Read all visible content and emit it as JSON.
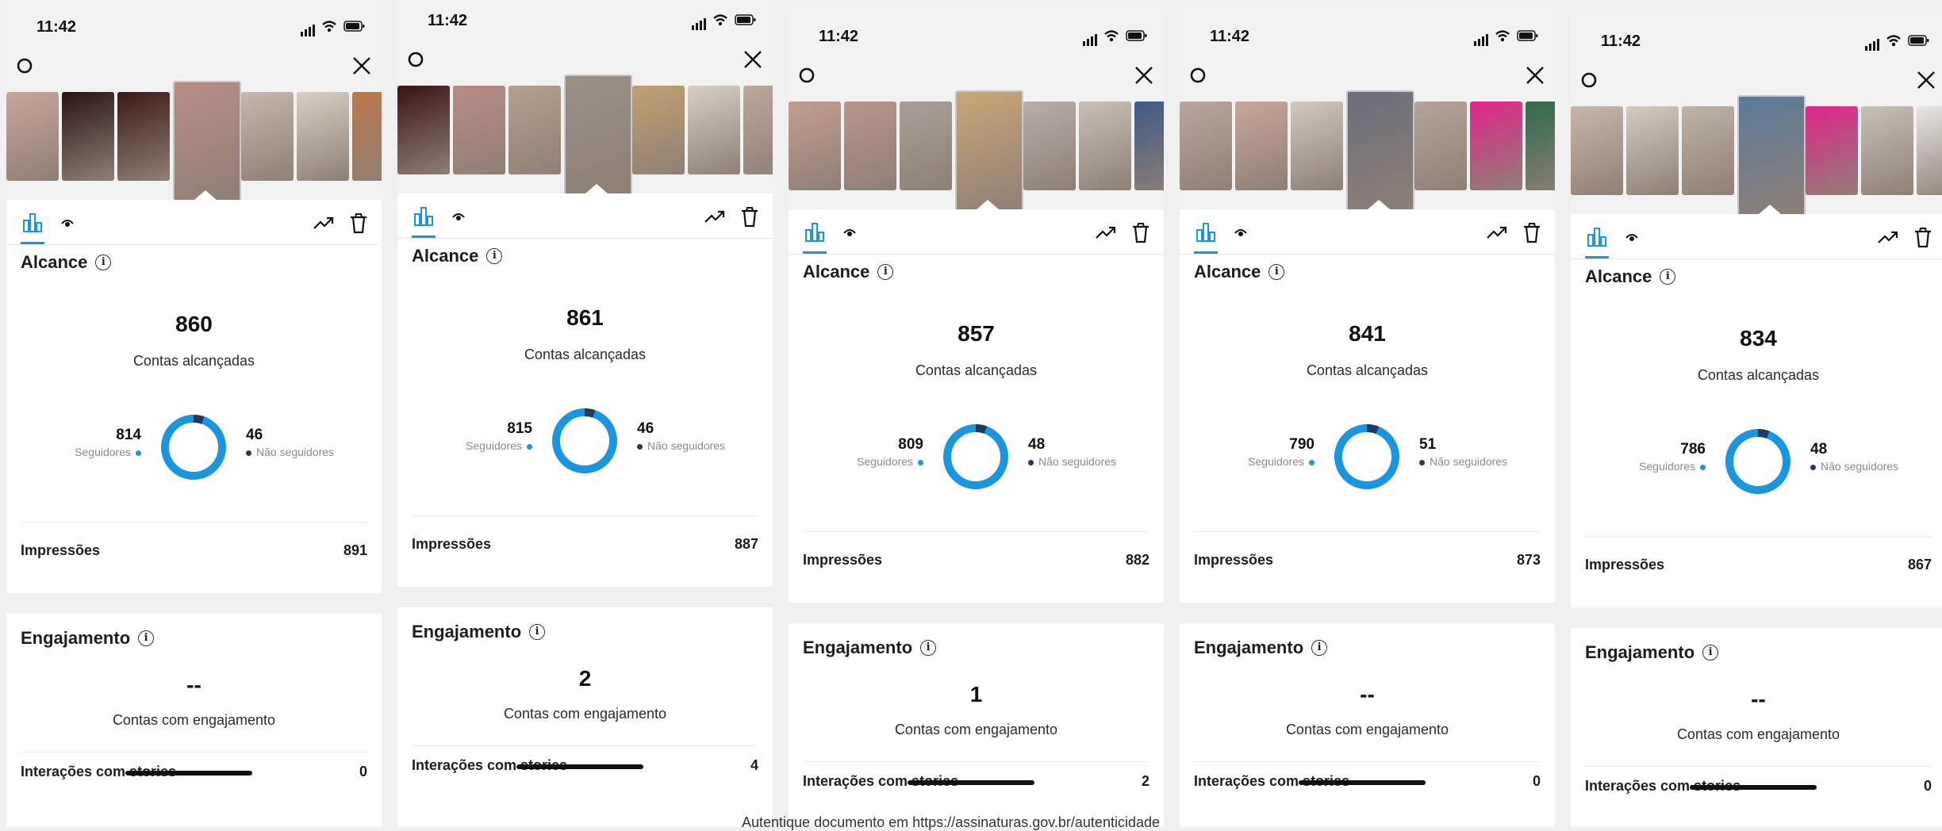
{
  "status": {
    "time": "11:42"
  },
  "labels": {
    "alcance": "Alcance",
    "contas_alcancadas": "Contas alcançadas",
    "seguidores": "Seguidores",
    "nao_seguidores": "Não seguidores",
    "impressoes": "Impressões",
    "engajamento": "Engajamento",
    "contas_engajamento": "Contas com engajamento",
    "interacoes": "Interações com stories",
    "info_glyph": "i"
  },
  "colors": {
    "followers": "#1a95e0",
    "non_followers": "#1f3a5f",
    "accent": "#1a95e0"
  },
  "icons": [
    "gear-icon",
    "close-icon",
    "insights-bar-icon",
    "eye-icon",
    "trend-icon",
    "trash-icon",
    "info-icon",
    "signal-icon",
    "wifi-icon",
    "battery-icon"
  ],
  "panels": [
    {
      "reach": "860",
      "followers": "814",
      "non_followers": "46",
      "impressions": "891",
      "engaged": "--",
      "interactions": "0"
    },
    {
      "reach": "861",
      "followers": "815",
      "non_followers": "46",
      "impressions": "887",
      "engaged": "2",
      "interactions": "4"
    },
    {
      "reach": "857",
      "followers": "809",
      "non_followers": "48",
      "impressions": "882",
      "engaged": "1",
      "interactions": "2"
    },
    {
      "reach": "841",
      "followers": "790",
      "non_followers": "51",
      "impressions": "873",
      "engaged": "--",
      "interactions": "0"
    },
    {
      "reach": "834",
      "followers": "786",
      "non_followers": "48",
      "impressions": "867",
      "engaged": "--",
      "interactions": "0"
    }
  ],
  "footer": {
    "text": "Autentique documento em https://assinaturas.gov.br/autenticidade"
  }
}
